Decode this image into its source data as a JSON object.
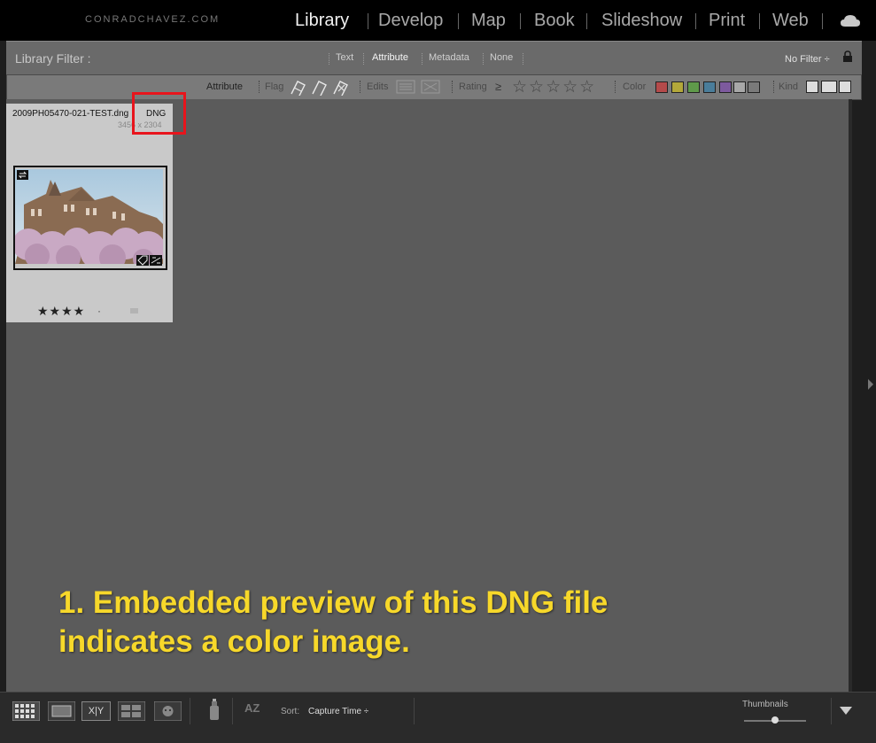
{
  "brand": "CONRADCHAVEZ.COM",
  "modules": [
    {
      "label": "Library",
      "active": true
    },
    {
      "label": "Develop",
      "active": false
    },
    {
      "label": "Map",
      "active": false
    },
    {
      "label": "Book",
      "active": false
    },
    {
      "label": "Slideshow",
      "active": false
    },
    {
      "label": "Print",
      "active": false
    },
    {
      "label": "Web",
      "active": false
    }
  ],
  "filter_bar": {
    "title": "Library Filter :",
    "tabs": [
      "Text",
      "Attribute",
      "Metadata",
      "None"
    ],
    "active_tab": "Attribute",
    "preset": "No Filter ÷"
  },
  "attribute_bar": {
    "label": "Attribute",
    "flag_label": "Flag",
    "edits_label": "Edits",
    "rating_label": "Rating",
    "rating_operator": "≥",
    "rating_stars": "☆☆☆☆☆",
    "color_label": "Color",
    "colors": [
      "#b44a4a",
      "#b3a83a",
      "#5f9a4a",
      "#4a7d9a",
      "#7d5a9e",
      "#a8a8a8",
      "#7a7a7a"
    ],
    "kind_label": "Kind"
  },
  "thumbnail": {
    "filename": "2009PH05470-021-TEST.dng",
    "file_type": "DNG",
    "dimensions": "3456 x 2304",
    "rating": "★★★★",
    "dot": "·"
  },
  "caption": {
    "line1": "1. Embedded preview of this DNG file",
    "line2": "indicates a color image."
  },
  "toolbar": {
    "sort_label": "Sort:",
    "sort_value": "Capture Time ÷",
    "thumbnails_label": "Thumbnails",
    "compare_label": "X|Y",
    "sort_icon_text": "AZ"
  }
}
